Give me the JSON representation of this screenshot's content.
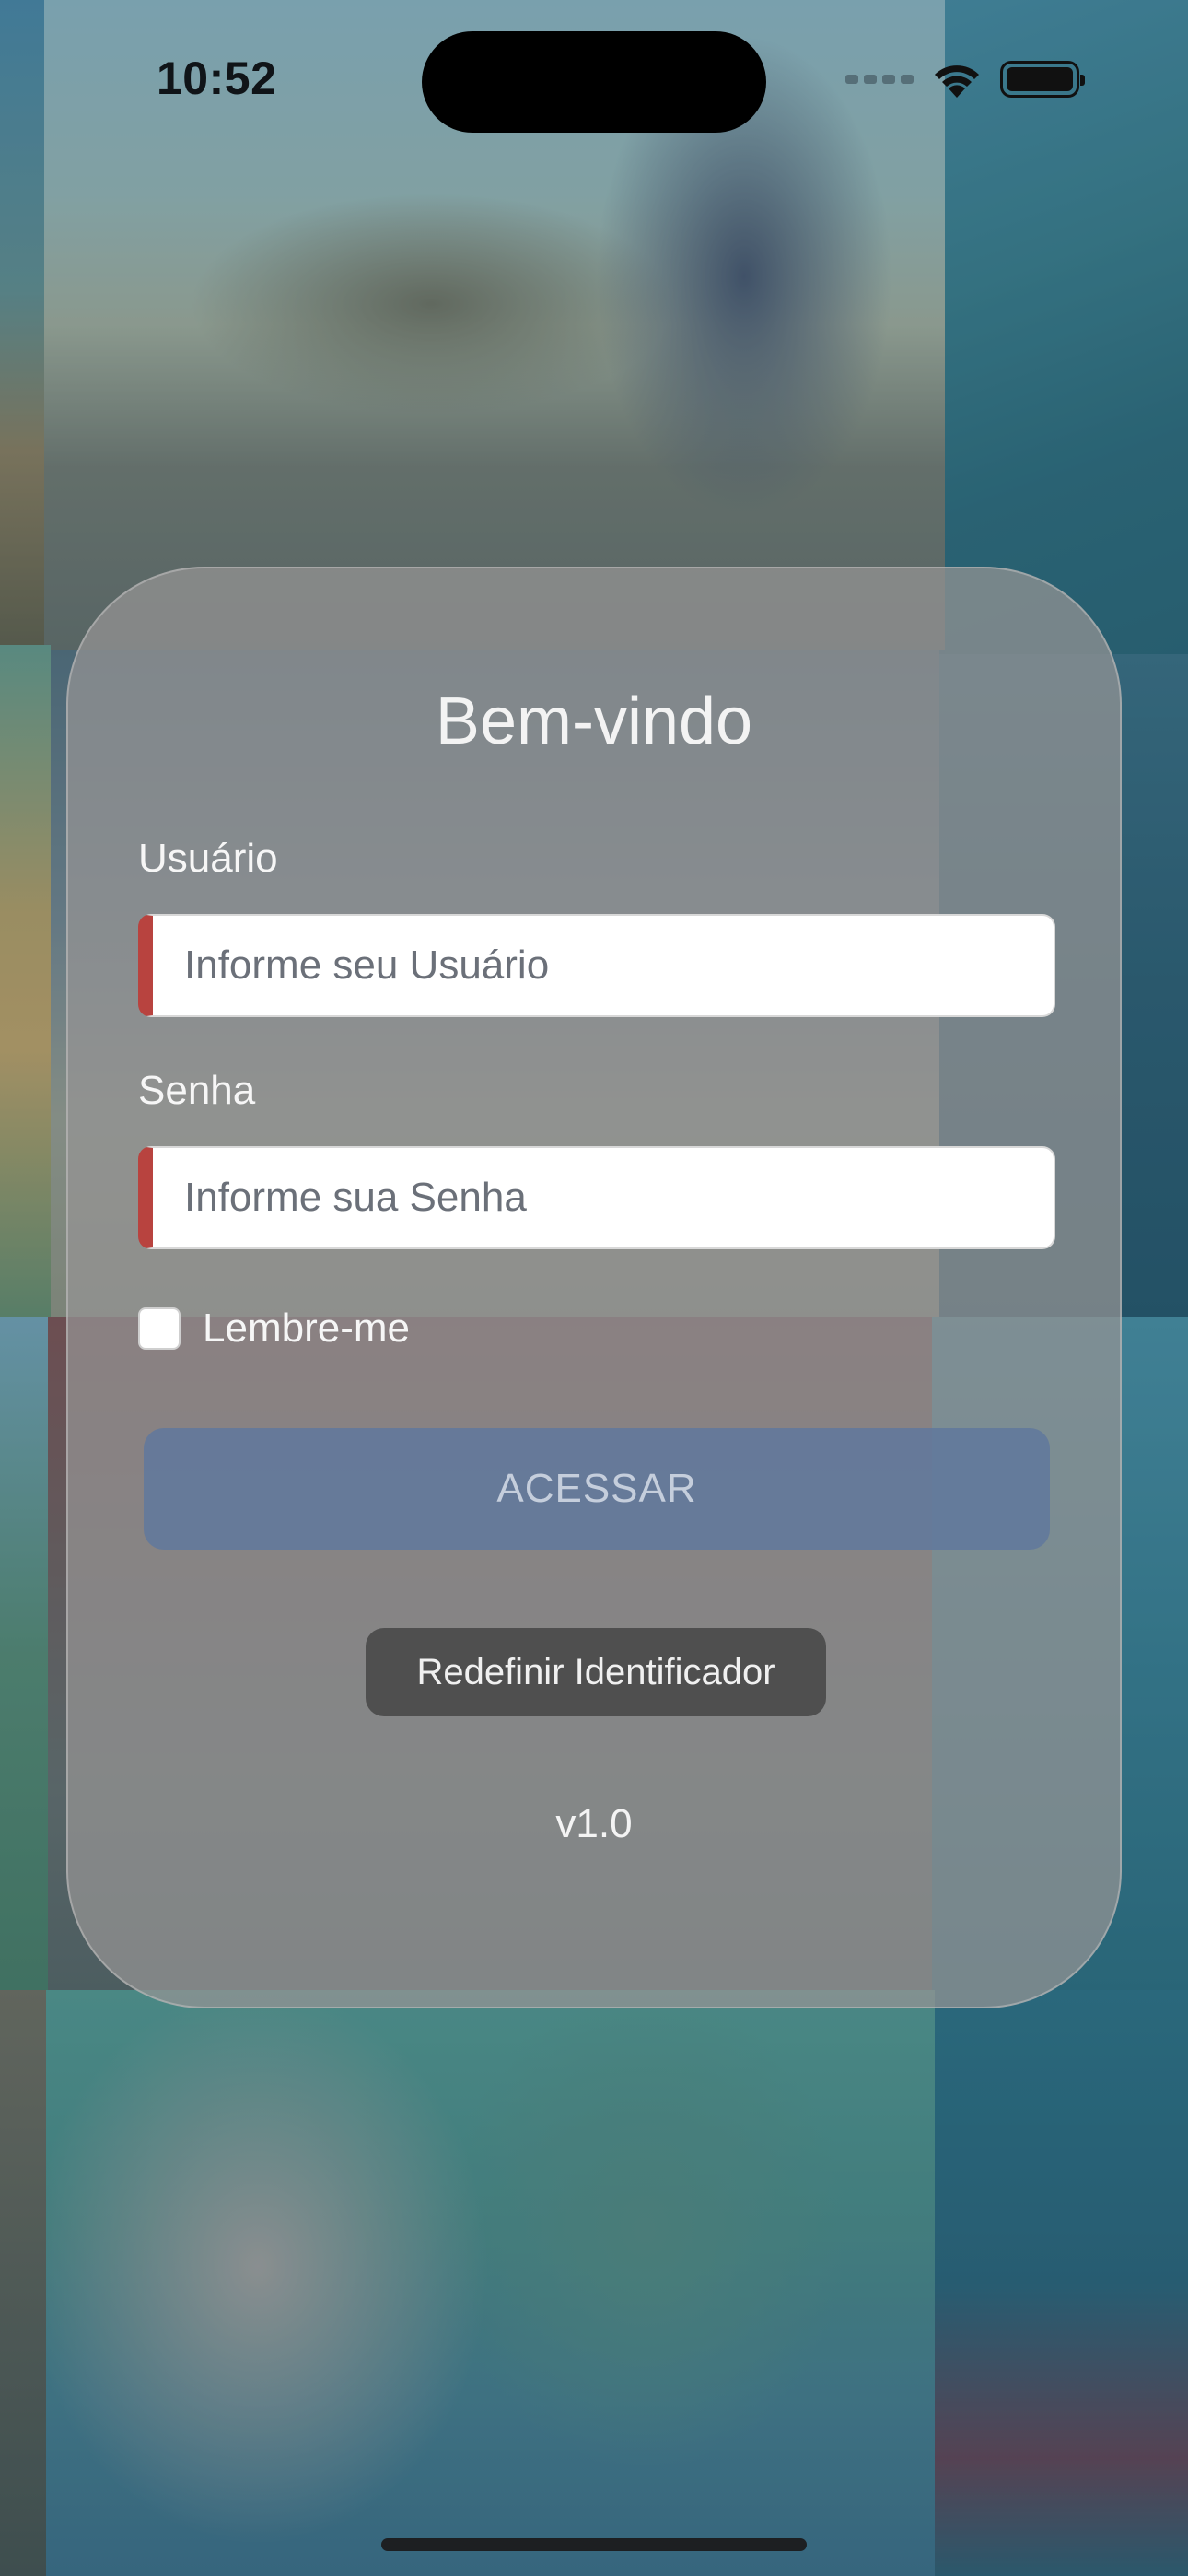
{
  "status_bar": {
    "time": "10:52",
    "icons": [
      "cellular-signal-icon",
      "wifi-icon",
      "battery-icon"
    ]
  },
  "login": {
    "title": "Bem-vindo",
    "username": {
      "label": "Usuário",
      "value": "",
      "placeholder": "Informe seu Usuário"
    },
    "password": {
      "label": "Senha",
      "value": "",
      "placeholder": "Informe sua Senha"
    },
    "remember": {
      "label": "Lembre-me",
      "checked": false
    },
    "submit_label": "ACESSAR",
    "reset_label": "Redefinir Identificador",
    "version": "v1.0"
  },
  "colors": {
    "required_marker": "#b8433f",
    "submit_button": "#5f789e",
    "reset_button": "#484848",
    "card": "#969494"
  }
}
